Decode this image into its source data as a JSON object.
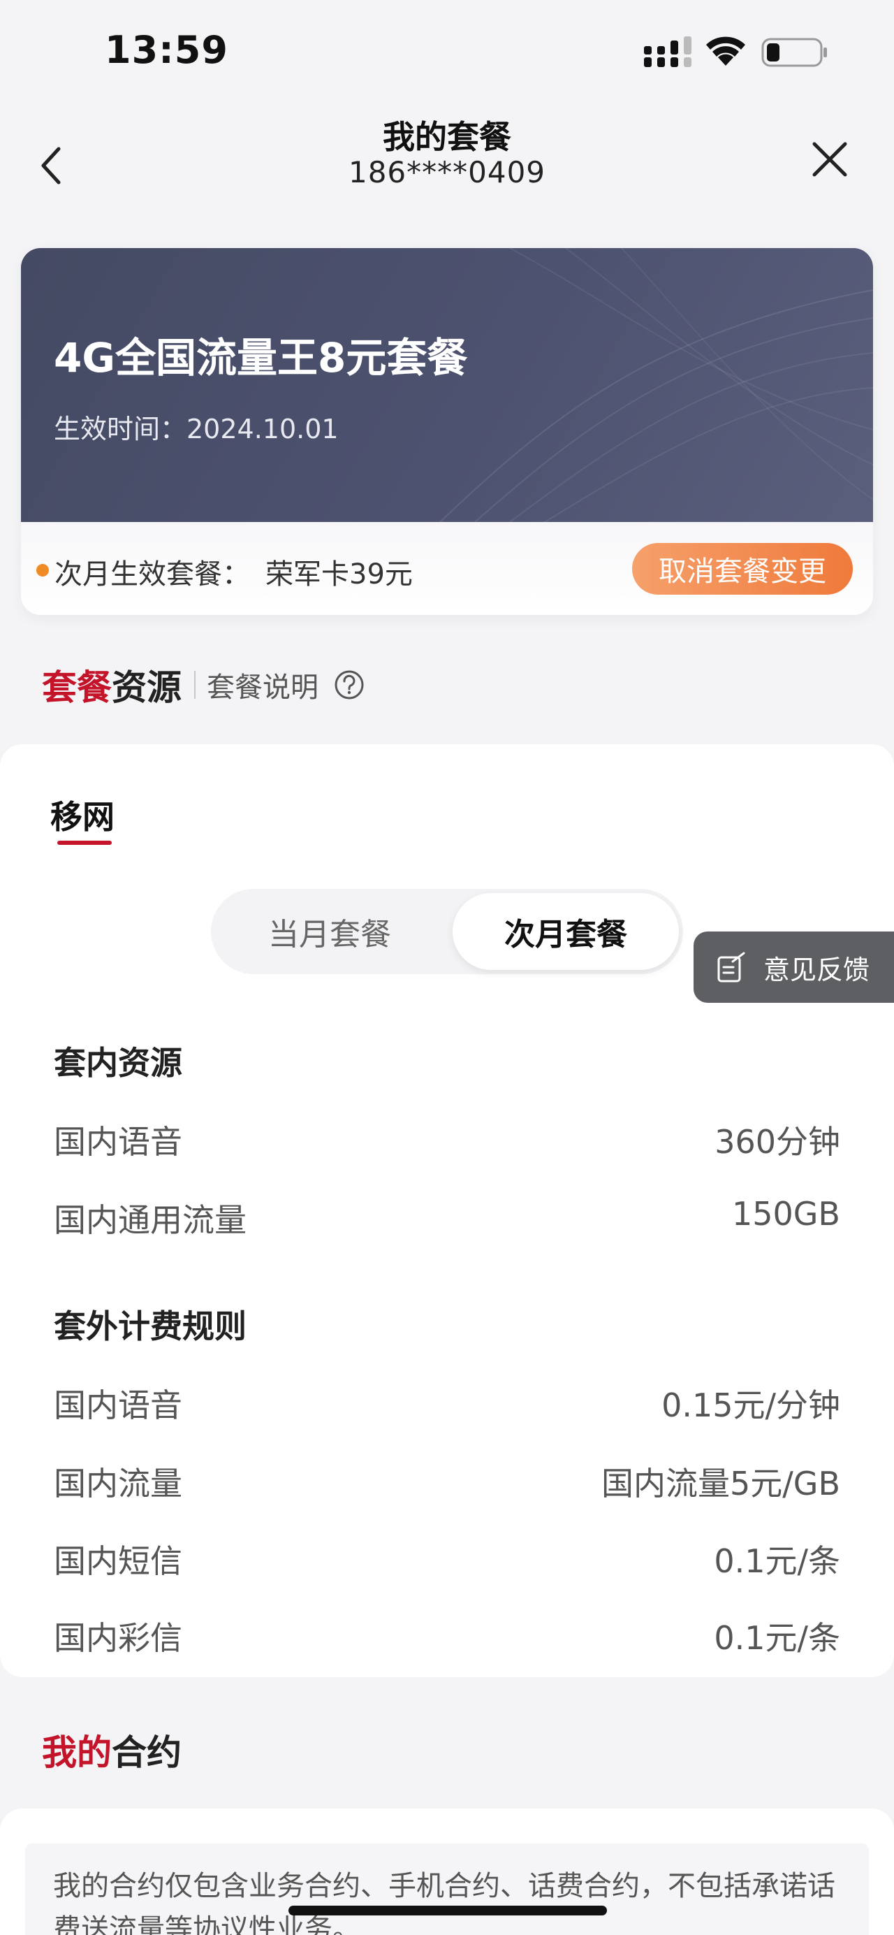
{
  "status_bar": {
    "time": "13:59"
  },
  "nav": {
    "title": "我的套餐",
    "phone": "186****0409"
  },
  "plan": {
    "name": "4G全国流量王8元套餐",
    "effective": "生效时间：2024.10.01",
    "next_month_label": "次月生效套餐：",
    "next_month_plan": "荣军卡39元",
    "cancel_button": "取消套餐变更"
  },
  "resources_header": {
    "title_accent": "套餐",
    "title_rest": "资源",
    "link": "套餐说明"
  },
  "network_tab": "移网",
  "month_toggle": {
    "current": "当月套餐",
    "next": "次月套餐"
  },
  "included": {
    "title": "套内资源",
    "rows": [
      {
        "label": "国内语音",
        "value": "360分钟"
      },
      {
        "label": "国内通用流量",
        "value": "150GB"
      }
    ]
  },
  "overage": {
    "title": "套外计费规则",
    "rows": [
      {
        "label": "国内语音",
        "value": "0.15元/分钟"
      },
      {
        "label": "国内流量",
        "value": "国内流量5元/GB"
      },
      {
        "label": "国内短信",
        "value": "0.1元/条"
      },
      {
        "label": "国内彩信",
        "value": "0.1元/条"
      }
    ]
  },
  "feedback": "意见反馈",
  "contract": {
    "title_accent": "我的",
    "title_rest": "合约",
    "note": "我的合约仅包含业务合约、手机合约、话费合约，不包括承诺话费送流量等协议性业务。"
  },
  "colors": {
    "accent_red": "#c3142a",
    "orange": "#ef7a3b",
    "card_dark": "#4d5270"
  }
}
